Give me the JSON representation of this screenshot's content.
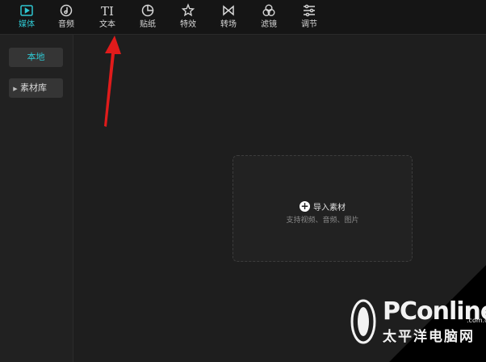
{
  "toolbar": {
    "items": [
      {
        "label": "媒体",
        "icon": "media-icon",
        "active": true
      },
      {
        "label": "音频",
        "icon": "audio-icon"
      },
      {
        "label": "文本",
        "icon": "text-icon",
        "glyph": "TI"
      },
      {
        "label": "贴纸",
        "icon": "sticker-icon"
      },
      {
        "label": "特效",
        "icon": "effects-icon"
      },
      {
        "label": "转场",
        "icon": "transition-icon"
      },
      {
        "label": "滤镜",
        "icon": "filter-icon"
      },
      {
        "label": "调节",
        "icon": "adjust-icon"
      }
    ]
  },
  "sidebar": {
    "local": "本地",
    "library": "素材库"
  },
  "main": {
    "import_label": "导入素材",
    "hint": "支持视频、音频、图片"
  },
  "watermark": {
    "brand": "PConline",
    "sub": "太平洋电脑网",
    "domain": ".com.cn"
  },
  "colors": {
    "accent": "#2fc7d1",
    "annotation_arrow": "#e01b1b"
  }
}
